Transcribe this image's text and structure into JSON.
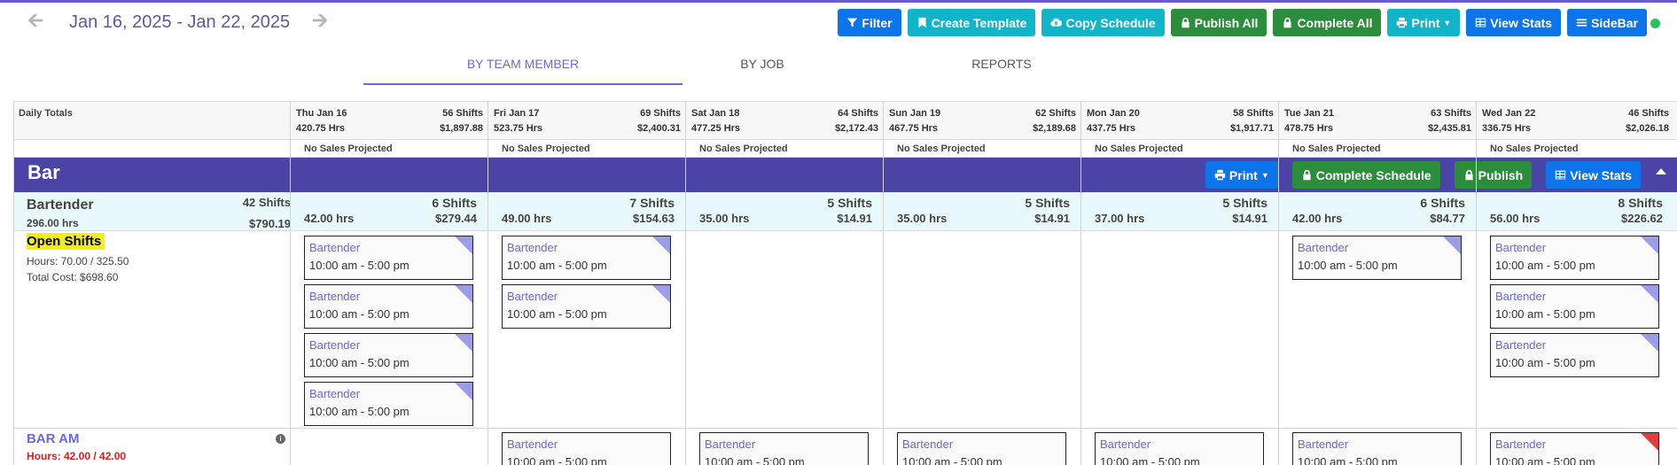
{
  "nav": {
    "prev_icon": "arrow-left-icon",
    "next_icon": "arrow-right-icon",
    "date_range": "Jan 16, 2025 - Jan 22, 2025"
  },
  "toolbar": {
    "filter": "Filter",
    "create_template": "Create Template",
    "copy_schedule": "Copy Schedule",
    "publish_all": "Publish All",
    "complete_all": "Complete All",
    "print": "Print",
    "view_stats": "View Stats",
    "sidebar": "SideBar"
  },
  "colors": {
    "blue": "#0d74ea",
    "teal": "#11b5c9",
    "green": "#2c8d3c",
    "section": "#4a44a6",
    "accent": "#6a6ad4",
    "status_online": "#2ebd59"
  },
  "tabs": [
    {
      "label": "BY TEAM MEMBER",
      "active": true
    },
    {
      "label": "BY JOB",
      "active": false
    },
    {
      "label": "REPORTS",
      "active": false
    }
  ],
  "totals_label": "Daily Totals",
  "days": [
    {
      "date": "Thu Jan 16",
      "shifts": "56 Shifts",
      "hrs": "420.75 Hrs",
      "cost": "$1,897.88",
      "sales": "No Sales Projected"
    },
    {
      "date": "Fri Jan 17",
      "shifts": "69 Shifts",
      "hrs": "523.75 Hrs",
      "cost": "$2,400.31",
      "sales": "No Sales Projected"
    },
    {
      "date": "Sat Jan 18",
      "shifts": "64 Shifts",
      "hrs": "477.25 Hrs",
      "cost": "$2,172.43",
      "sales": "No Sales Projected"
    },
    {
      "date": "Sun Jan 19",
      "shifts": "62 Shifts",
      "hrs": "467.75 Hrs",
      "cost": "$2,189.68",
      "sales": "No Sales Projected"
    },
    {
      "date": "Mon Jan 20",
      "shifts": "58 Shifts",
      "hrs": "437.75 Hrs",
      "cost": "$1,917.71",
      "sales": "No Sales Projected"
    },
    {
      "date": "Tue Jan 21",
      "shifts": "63 Shifts",
      "hrs": "478.75 Hrs",
      "cost": "$2,435.81",
      "sales": "No Sales Projected"
    },
    {
      "date": "Wed Jan 22",
      "shifts": "46 Shifts",
      "hrs": "336.75 Hrs",
      "cost": "$2,026.18",
      "sales": "No Sales Projected"
    }
  ],
  "section": {
    "title": "Bar",
    "print": "Print",
    "complete_schedule": "Complete Schedule",
    "publish": "Publish",
    "view_stats": "View Stats"
  },
  "role": {
    "name": "Bartender",
    "total_shifts": "42 Shifts",
    "total_hrs": "296.00 hrs",
    "total_cost": "$790.19",
    "days": [
      {
        "shifts": "6 Shifts",
        "hrs": "42.00 hrs",
        "cost": "$279.44"
      },
      {
        "shifts": "7 Shifts",
        "hrs": "49.00 hrs",
        "cost": "$154.63"
      },
      {
        "shifts": "5 Shifts",
        "hrs": "35.00 hrs",
        "cost": "$14.91"
      },
      {
        "shifts": "5 Shifts",
        "hrs": "35.00 hrs",
        "cost": "$14.91"
      },
      {
        "shifts": "5 Shifts",
        "hrs": "37.00 hrs",
        "cost": "$14.91"
      },
      {
        "shifts": "6 Shifts",
        "hrs": "42.00 hrs",
        "cost": "$84.77"
      },
      {
        "shifts": "8 Shifts",
        "hrs": "56.00 hrs",
        "cost": "$226.62"
      }
    ]
  },
  "open_shifts": {
    "title": "Open Shifts",
    "hours": "Hours: 70.00 / 325.50",
    "cost": "Total Cost: $698.60",
    "counts": [
      4,
      2,
      0,
      0,
      0,
      1,
      3
    ],
    "job": "Bartender",
    "time": "10:00 am - 5:00 pm"
  },
  "team_member": {
    "name": "BAR AM",
    "hours_label": "Hours: ",
    "hours_value": "42.00",
    "hours_sep": " / ",
    "hours_max": "42.00",
    "info_icon": "info-icon",
    "shift_days": [
      1,
      2,
      3,
      4,
      5,
      6
    ],
    "job": "Bartender",
    "time": "10:00 am - 5:00 pm"
  }
}
